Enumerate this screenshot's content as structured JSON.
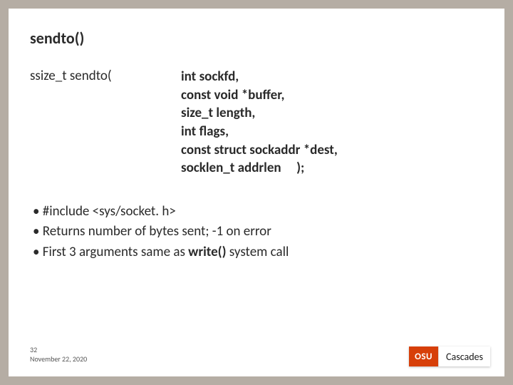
{
  "title": "sendto()",
  "signature": {
    "left": "ssize_t sendto(",
    "params": [
      "int sockfd,",
      "const void *buffer,",
      "size_t length,",
      "int flags,",
      "const struct sockaddr *dest,",
      "socklen_t addrlen     );"
    ]
  },
  "bullets": [
    {
      "pre": "#include <sys/socket. h>",
      "bold": "",
      "post": ""
    },
    {
      "pre": "Returns number of bytes sent; -1 on error",
      "bold": "",
      "post": ""
    },
    {
      "pre": "First 3 arguments same as ",
      "bold": "write()",
      "post": " system call"
    }
  ],
  "footer": {
    "slide_number": "32",
    "date": "November 22, 2020"
  },
  "logo": {
    "left": "OSU",
    "right": "Cascades"
  }
}
